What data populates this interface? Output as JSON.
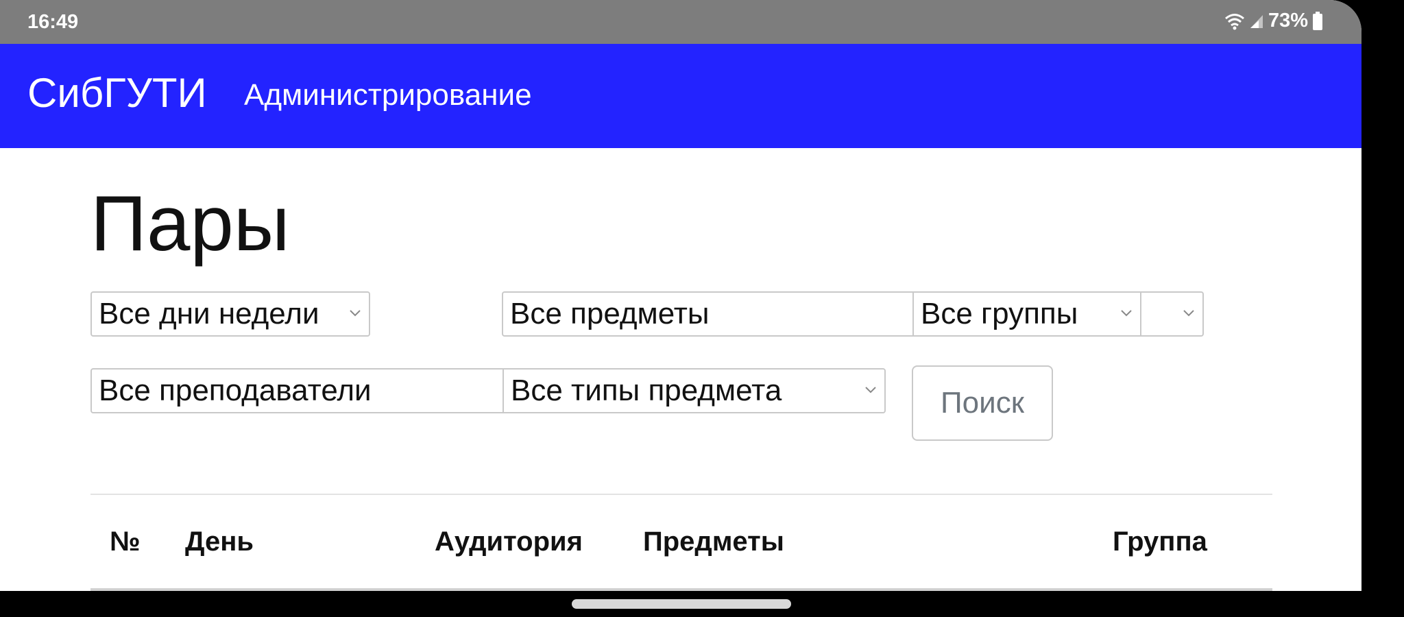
{
  "status_bar": {
    "time": "16:49",
    "battery": "73%",
    "icons": [
      "wifi-icon",
      "signal-icon",
      "battery-icon"
    ]
  },
  "navbar": {
    "brand": "СибГУТИ",
    "link": "Администрирование",
    "color": "#2323ff"
  },
  "page": {
    "title": "Пары"
  },
  "filters": {
    "days": {
      "value": "Все дни недели",
      "icon": "chevron-down-icon"
    },
    "subjects": {
      "placeholder": "Все предметы"
    },
    "groups": {
      "value": "Все группы",
      "icon": "chevron-down-icon"
    },
    "extra": {
      "value": "",
      "icon": "chevron-down-icon"
    },
    "teachers": {
      "placeholder": "Все преподаватели"
    },
    "types": {
      "value": "Все типы предмета",
      "icon": "chevron-down-icon"
    },
    "search_label": "Поиск"
  },
  "table": {
    "columns": [
      "№",
      "День",
      "Аудитория",
      "Предметы",
      "Группа"
    ]
  }
}
